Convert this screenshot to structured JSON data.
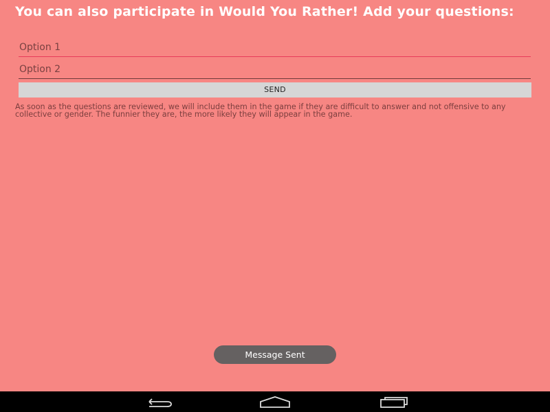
{
  "heading": "You can also participate in Would You Rather! Add your questions:",
  "form": {
    "option1_placeholder": "Option 1",
    "option2_placeholder": "Option 2",
    "send_label": "SEND"
  },
  "info_text": "As soon as the questions are reviewed, we will include them in the game if they are difficult to answer and not offensive to any collective or gender. The funnier they are, the more likely they will appear in the game.",
  "toast": "Message Sent",
  "nav": {
    "back_icon": "back-icon",
    "home_icon": "home-icon",
    "recents_icon": "recents-icon"
  },
  "colors": {
    "background": "#f78683",
    "active_underline": "#e83a5a",
    "button": "#d6d6d6",
    "toast": "#656161",
    "navbar": "#000000"
  }
}
